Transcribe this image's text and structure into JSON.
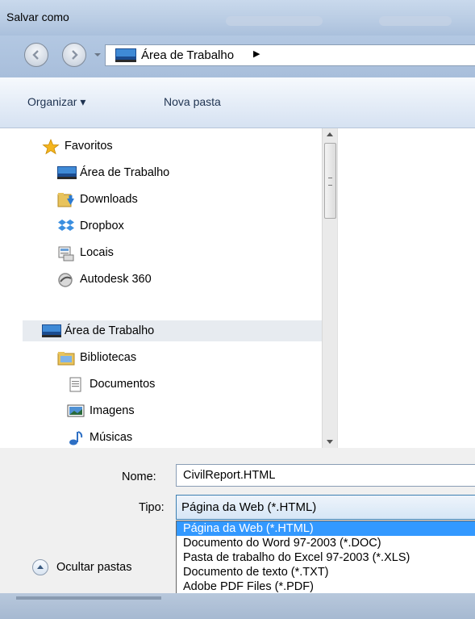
{
  "window": {
    "title": "Salvar como"
  },
  "address_bar": {
    "path": [
      "Área de Trabalho"
    ],
    "separator_icon": "chevron-right-icon"
  },
  "toolbar": {
    "organize_label": "Organizar ▾",
    "new_folder_label": "Nova pasta"
  },
  "nav_pane": {
    "favorites": {
      "label": "Favoritos",
      "items": [
        {
          "label": "Área de Trabalho",
          "icon": "desktop-icon"
        },
        {
          "label": "Downloads",
          "icon": "downloads-folder-icon"
        },
        {
          "label": "Dropbox",
          "icon": "dropbox-icon"
        },
        {
          "label": "Locais",
          "icon": "places-icon"
        },
        {
          "label": "Autodesk 360",
          "icon": "autodesk-360-icon"
        }
      ]
    },
    "desktop_group": {
      "label": "Área de Trabalho",
      "items": [
        {
          "label": "Bibliotecas",
          "icon": "libraries-icon"
        },
        {
          "label": "Documentos",
          "icon": "documents-icon"
        },
        {
          "label": "Imagens",
          "icon": "pictures-icon"
        },
        {
          "label": "Músicas",
          "icon": "music-icon"
        }
      ]
    }
  },
  "form": {
    "name_label": "Nome:",
    "name_value": "CivilReport.HTML",
    "type_label": "Tipo:",
    "type_value": "Página da Web (*.HTML)",
    "type_options": [
      "Página da Web (*.HTML)",
      "Documento do Word 97-2003 (*.DOC)",
      "Pasta de trabalho do Excel 97-2003 (*.XLS)",
      "Documento de texto (*.TXT)",
      "Adobe PDF Files (*.PDF)"
    ],
    "selected_option_index": 0
  },
  "footer": {
    "hide_folders_label": "Ocultar pastas"
  },
  "colors": {
    "selection": "#3399ff",
    "toolbar_text": "#1e3250",
    "frame": "#b3c8e2"
  }
}
